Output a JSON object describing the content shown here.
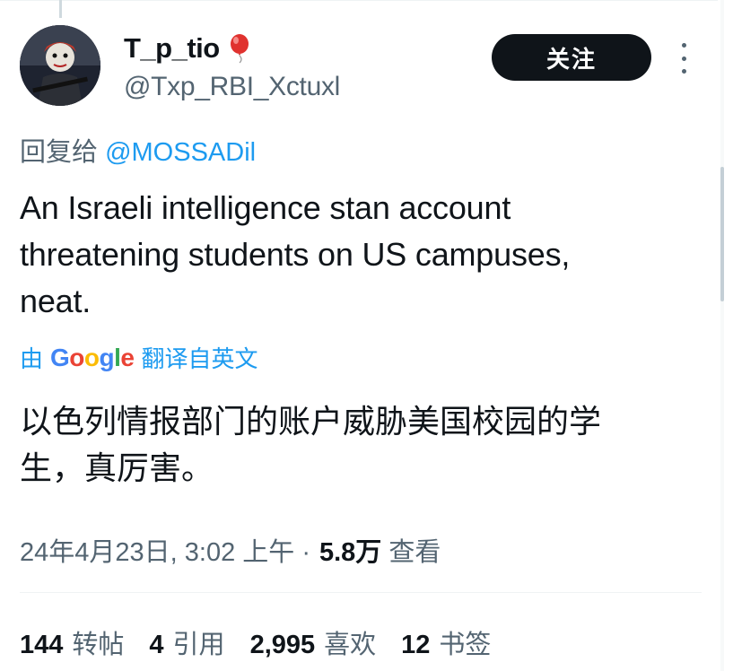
{
  "author": {
    "display_name": "T_p_tio",
    "handle": "@Txp_RBI_Xctuxl",
    "badge_icon": "balloon-emoji",
    "avatar_icon": "clown-avatar"
  },
  "actions": {
    "follow_label": "关注",
    "more_icon": "more-vertical-icon"
  },
  "reply": {
    "prefix": "回复给",
    "mention": "@MOSSADil"
  },
  "tweet": {
    "lines": [
      "An Israeli intelligence stan account",
      "threatening students on US campuses,",
      "neat."
    ]
  },
  "translation": {
    "by": "由",
    "provider": "Google",
    "suffix": "翻译自英文",
    "lines": [
      "以色列情报部门的账户威胁美国校园的学",
      "生，真厉害。"
    ]
  },
  "meta": {
    "timestamp": "24年4月23日, 3:02 上午 ·",
    "views": "5.8万",
    "views_label": "查看"
  },
  "stats": {
    "retweets": "144",
    "retweets_label": "转帖",
    "quotes": "4",
    "quotes_label": "引用",
    "likes": "2,995",
    "likes_label": "喜欢",
    "bookmarks": "12",
    "bookmarks_label": "书签"
  },
  "colors": {
    "accent": "#1d9bf0",
    "text_primary": "#0f1419",
    "text_secondary": "#536471",
    "button_bg": "#0f1419"
  }
}
